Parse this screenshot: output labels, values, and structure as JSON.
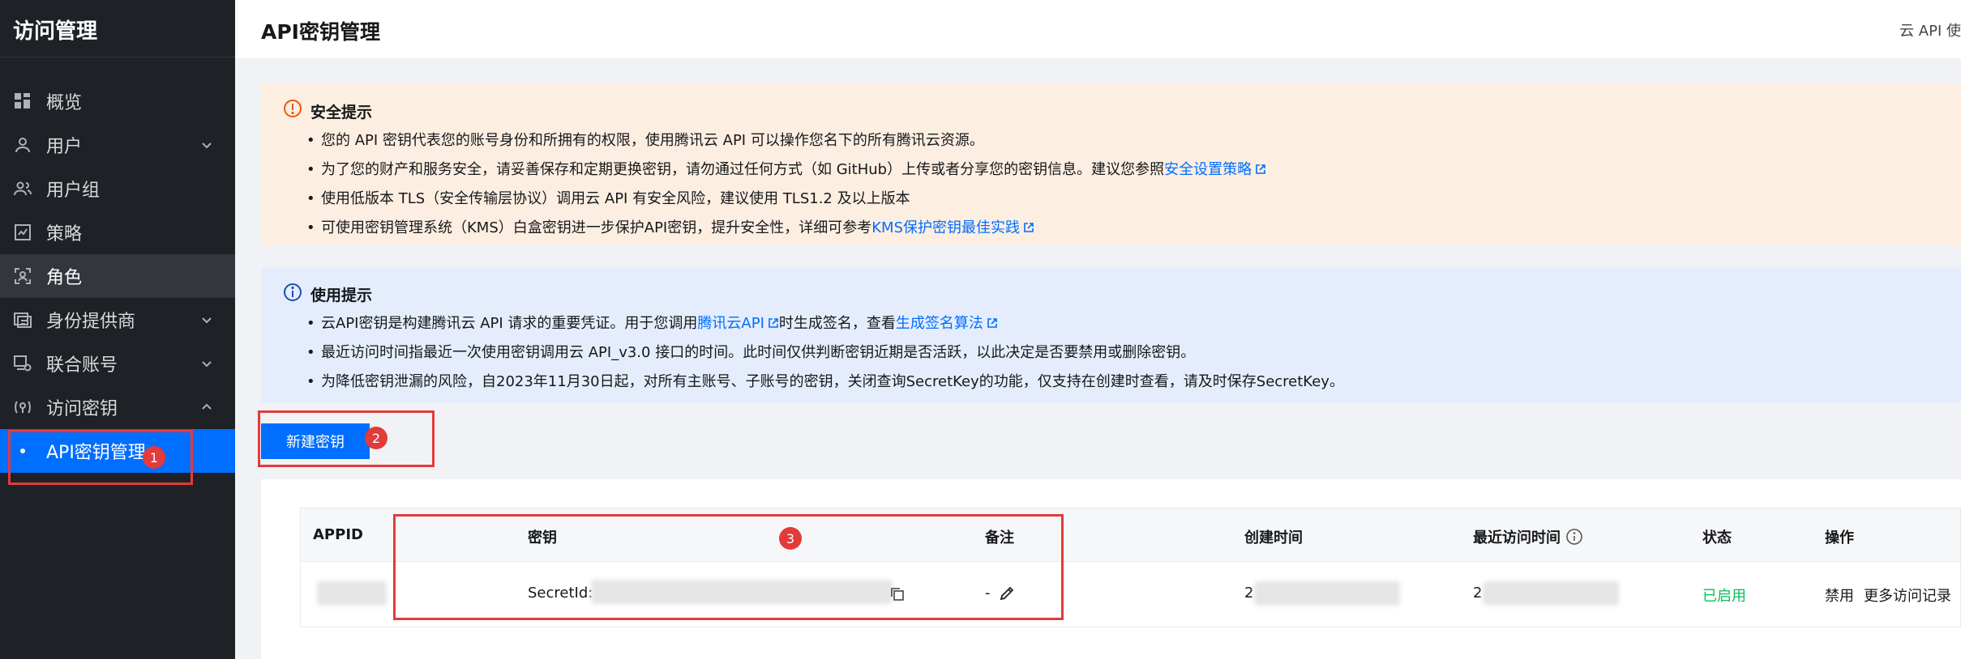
{
  "sidebar": {
    "title": "访问管理",
    "items": [
      {
        "label": "概览"
      },
      {
        "label": "用户"
      },
      {
        "label": "用户组"
      },
      {
        "label": "策略"
      },
      {
        "label": "角色"
      },
      {
        "label": "身份提供商"
      },
      {
        "label": "联合账号"
      },
      {
        "label": "访问密钥"
      },
      {
        "label": "API密钥管理"
      }
    ]
  },
  "header": {
    "title": "API密钥管理",
    "right_text": "云 API 使"
  },
  "security_notice": {
    "title": "安全提示",
    "lines": [
      {
        "text": "您的 API 密钥代表您的账号身份和所拥有的权限，使用腾讯云 API 可以操作您名下的所有腾讯云资源。"
      },
      {
        "text": "为了您的财产和服务安全，请妥善保存和定期更换密钥，请勿通过任何方式（如 GitHub）上传或者分享您的密钥信息。建议您参照",
        "link": "安全设置策略"
      },
      {
        "text": "使用低版本 TLS（安全传输层协议）调用云 API 有安全风险，建议使用 TLS1.2 及以上版本"
      },
      {
        "text": "可使用密钥管理系统（KMS）白盒密钥进一步保护API密钥，提升安全性，详细可参考",
        "link": "KMS保护密钥最佳实践"
      }
    ]
  },
  "usage_notice": {
    "title": "使用提示",
    "line1": {
      "text_a": "云API密钥是构建腾讯云 API 请求的重要凭证。用于您调用",
      "link_a": "腾讯云API",
      "text_b": "时生成签名，查看",
      "link_b": "生成签名算法"
    },
    "line2": "最近访问时间指最近一次使用密钥调用云 API_v3.0 接口的时间。此时间仅供判断密钥近期是否活跃，以此决定是否要禁用或删除密钥。",
    "line3": "为降低密钥泄漏的风险，自2023年11月30日起，对所有主账号、子账号的密钥，关闭查询SecretKey的功能，仅支持在创建时查看，请及时保存SecretKey。"
  },
  "buttons": {
    "new_key": "新建密钥"
  },
  "table": {
    "headers": {
      "appid": "APPID",
      "key": "密钥",
      "remark": "备注",
      "created": "创建时间",
      "last_access": "最近访问时间",
      "status": "状态",
      "actions": "操作"
    },
    "row": {
      "secret_id_label": "SecretId:",
      "remark": "-",
      "created_prefix": "2",
      "last_access_prefix": "2",
      "status": "已启用",
      "action_disable": "禁用",
      "action_more": "更多访问记录"
    }
  },
  "annotations": {
    "badge1": "1",
    "badge2": "2",
    "badge3": "3"
  },
  "colors": {
    "sidebar_bg": "#1e2125",
    "active_blue": "#006eff",
    "warn_bg": "#fdeee2",
    "info_bg": "#e5edfd",
    "annotation_red": "#e23b3b",
    "status_green": "#0abf5b"
  }
}
